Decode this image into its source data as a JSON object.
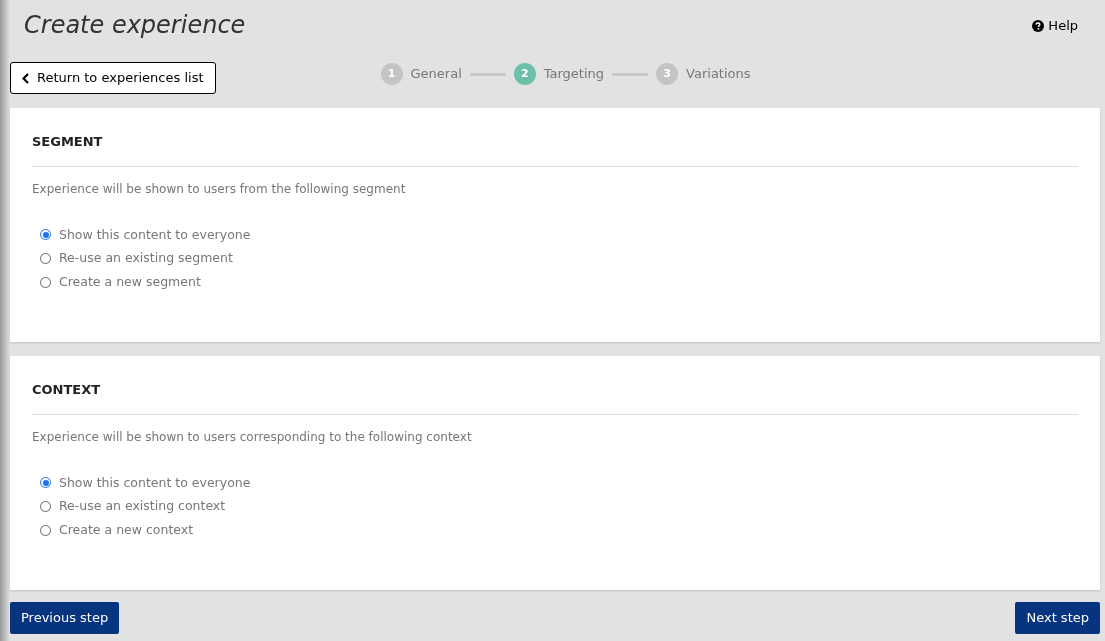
{
  "title": "Create experience",
  "help": "Help",
  "back_button": "Return to experiences list",
  "steps": [
    {
      "number": "1",
      "label": "General",
      "selected": false
    },
    {
      "number": "2",
      "label": "Targeting",
      "selected": true
    },
    {
      "number": "3",
      "label": "Variations",
      "selected": false
    }
  ],
  "sections": [
    {
      "heading": "SEGMENT",
      "description": "Experience will be shown to users from the following segment",
      "options": [
        {
          "label": "Show this content to everyone",
          "selected": true
        },
        {
          "label": "Re-use an existing segment",
          "selected": false
        },
        {
          "label": "Create a new segment",
          "selected": false
        }
      ]
    },
    {
      "heading": "CONTEXT",
      "description": "Experience will be shown to users corresponding to the following context",
      "options": [
        {
          "label": "Show this content to everyone",
          "selected": true
        },
        {
          "label": "Re-use an existing context",
          "selected": false
        },
        {
          "label": "Create a new context",
          "selected": false
        }
      ]
    }
  ],
  "footer": {
    "previous": "Previous step",
    "next": "Next step"
  }
}
